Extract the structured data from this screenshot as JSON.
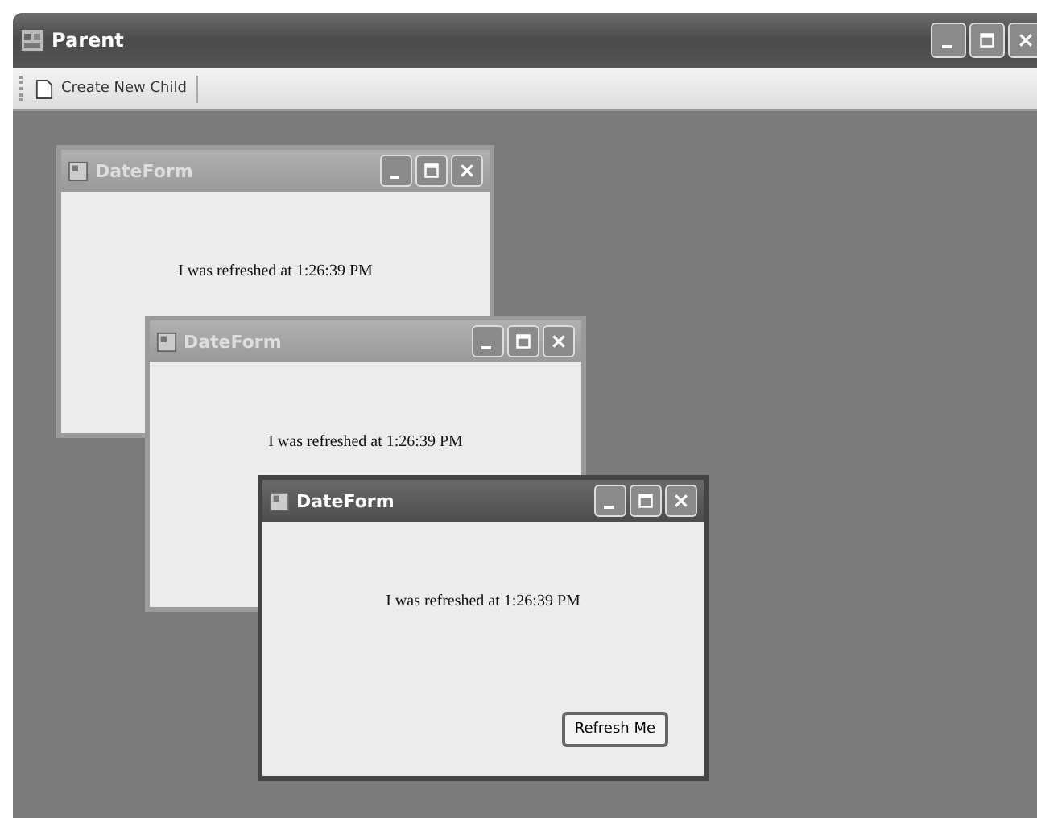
{
  "window": {
    "title": "Parent"
  },
  "toolbar": {
    "buttons": [
      "Create New Child"
    ]
  },
  "children": [
    {
      "title": "DateForm",
      "message": "I was refreshed at 1:26:39 PM",
      "active": false
    },
    {
      "title": "DateForm",
      "message": "I was refreshed at 1:26:39 PM",
      "active": false
    },
    {
      "title": "DateForm",
      "message": "I was refreshed at 1:26:39 PM",
      "active": true,
      "button": "Refresh Me"
    }
  ]
}
